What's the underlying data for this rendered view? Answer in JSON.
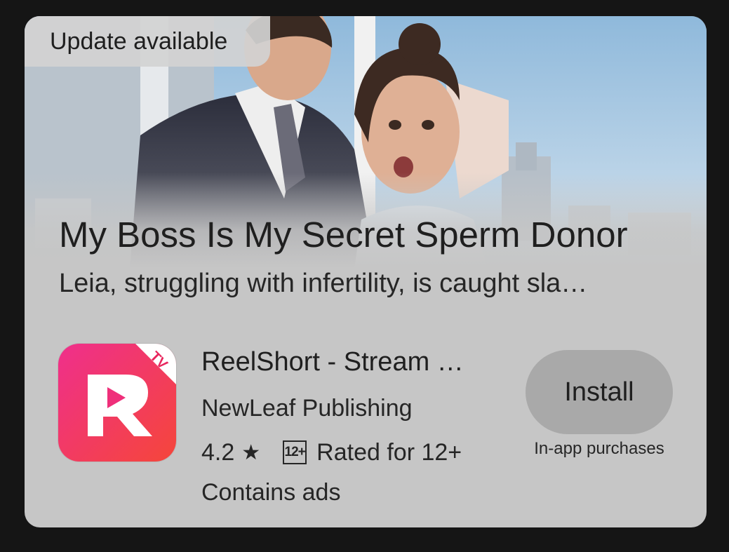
{
  "badge": {
    "update_label": "Update available"
  },
  "promo": {
    "title": "My Boss Is My Secret Sperm Donor",
    "description": "Leia, struggling with infertility, is caught sla…"
  },
  "app": {
    "name": "ReelShort - Stream …",
    "publisher": "NewLeaf Publishing",
    "rating": "4.2",
    "star_glyph": "★",
    "age_badge": "12+",
    "content_rating": "Rated for 12+",
    "ads_note": "Contains ads",
    "icon_letter": "R",
    "icon_corner": "TV"
  },
  "actions": {
    "install_label": "Install",
    "iap_note": "In-app purchases"
  },
  "colors": {
    "card_bg": "#c6c6c6",
    "page_bg": "#151515",
    "button_bg": "#a9a9a9",
    "icon_gradient_top": "#ef2f8c",
    "icon_gradient_bottom": "#f5463a"
  }
}
